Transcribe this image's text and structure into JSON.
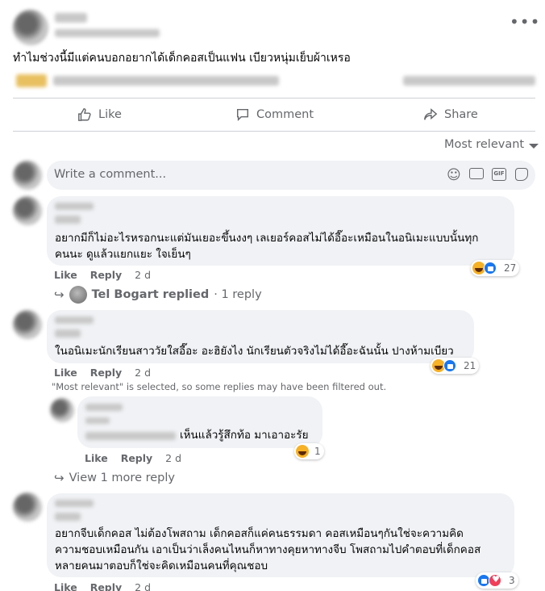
{
  "post": {
    "text": "ทำไมช่วงนี้มีแต่คนบอกอยากได้เด็กคอสเป็นแฟน เบียวหนุ่มเย็บผ้าเหรอ",
    "more_icon": "ellipsis-icon"
  },
  "actions": {
    "like": "Like",
    "comment": "Comment",
    "share": "Share"
  },
  "sort": {
    "label": "Most relevant"
  },
  "composer": {
    "placeholder": "Write a comment..."
  },
  "comments": [
    {
      "text": "อยากมีก็ไม่อะไรหรอกนะแต่มันเยอะขึ้นงงๆ เลเยอร์คอสไม่ได้อี๊อะเหมือนในอนิเมะแบบนั้นทุก\nคนนะ ดูแล้วแยกแยะ ใจเย็นๆ",
      "like": "Like",
      "reply": "Reply",
      "time": "2 d",
      "reaction_count": "27",
      "replied_by": "Tel Bogart replied",
      "reply_count": "· 1 reply"
    },
    {
      "text": "ในอนิเมะนักเรียนสาววัยใสอี๊อะ อะฮิยังไง นักเรียนตัวจริงไม่ได้อี๊อะฉันนั้น ปางห้ามเบียว",
      "like": "Like",
      "reply": "Reply",
      "time": "2 d",
      "reaction_count": "21",
      "filter_notice": "\"Most relevant\" is selected, so some replies may have been filtered out.",
      "nested_reply": {
        "text": "เห็นแล้วรู้สึกท้อ มาเอาอะรัย",
        "like": "Like",
        "reply": "Reply",
        "time": "2 d",
        "reaction_count": "1"
      },
      "view_more": "View 1 more reply"
    },
    {
      "text": "อยากจีบเด็กคอส ไม่ต้องโพสถาม เด็กคอสก็แค่คนธรรมดา คอสเหมือนๆกันใช่จะความคิด\nความชอบเหมือนกัน เอาเป็นว่าเล็งคนไหนก็หาทางคุยหาทางจีบ โพสถามไปคำตอบที่เด็กคอส\nหลายคนมาตอบก็ใช่จะคิดเหมือนคนที่คุณชอบ",
      "like": "Like",
      "reply": "Reply",
      "time": "2 d",
      "reaction_count": "3"
    }
  ]
}
